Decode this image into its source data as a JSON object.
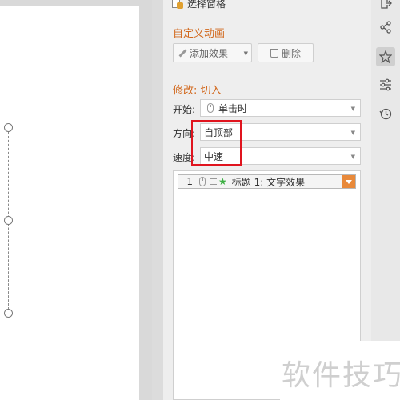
{
  "pane": {
    "header_title": "选择窗格",
    "custom_animation_title": "自定义动画",
    "add_effect_label": "添加效果",
    "delete_label": "删除",
    "modify_title": "修改: 切入",
    "start_label": "开始:",
    "start_value": "单击时",
    "direction_label": "方向:",
    "direction_value": "自顶部",
    "speed_label": "速度:",
    "speed_value": "中速"
  },
  "animation_list": [
    {
      "index": "1",
      "name": "标题 1: 文字效果"
    }
  ],
  "toolbar": {
    "icons": [
      "move-icon",
      "share-icon",
      "animation-star-icon",
      "settings-sliders-icon",
      "history-icon"
    ]
  },
  "watermark_text": "软件技巧",
  "colors": {
    "accent_orange": "#d2691e",
    "highlight_red": "#e0141e",
    "list_dropdown_orange": "#e8893a"
  }
}
